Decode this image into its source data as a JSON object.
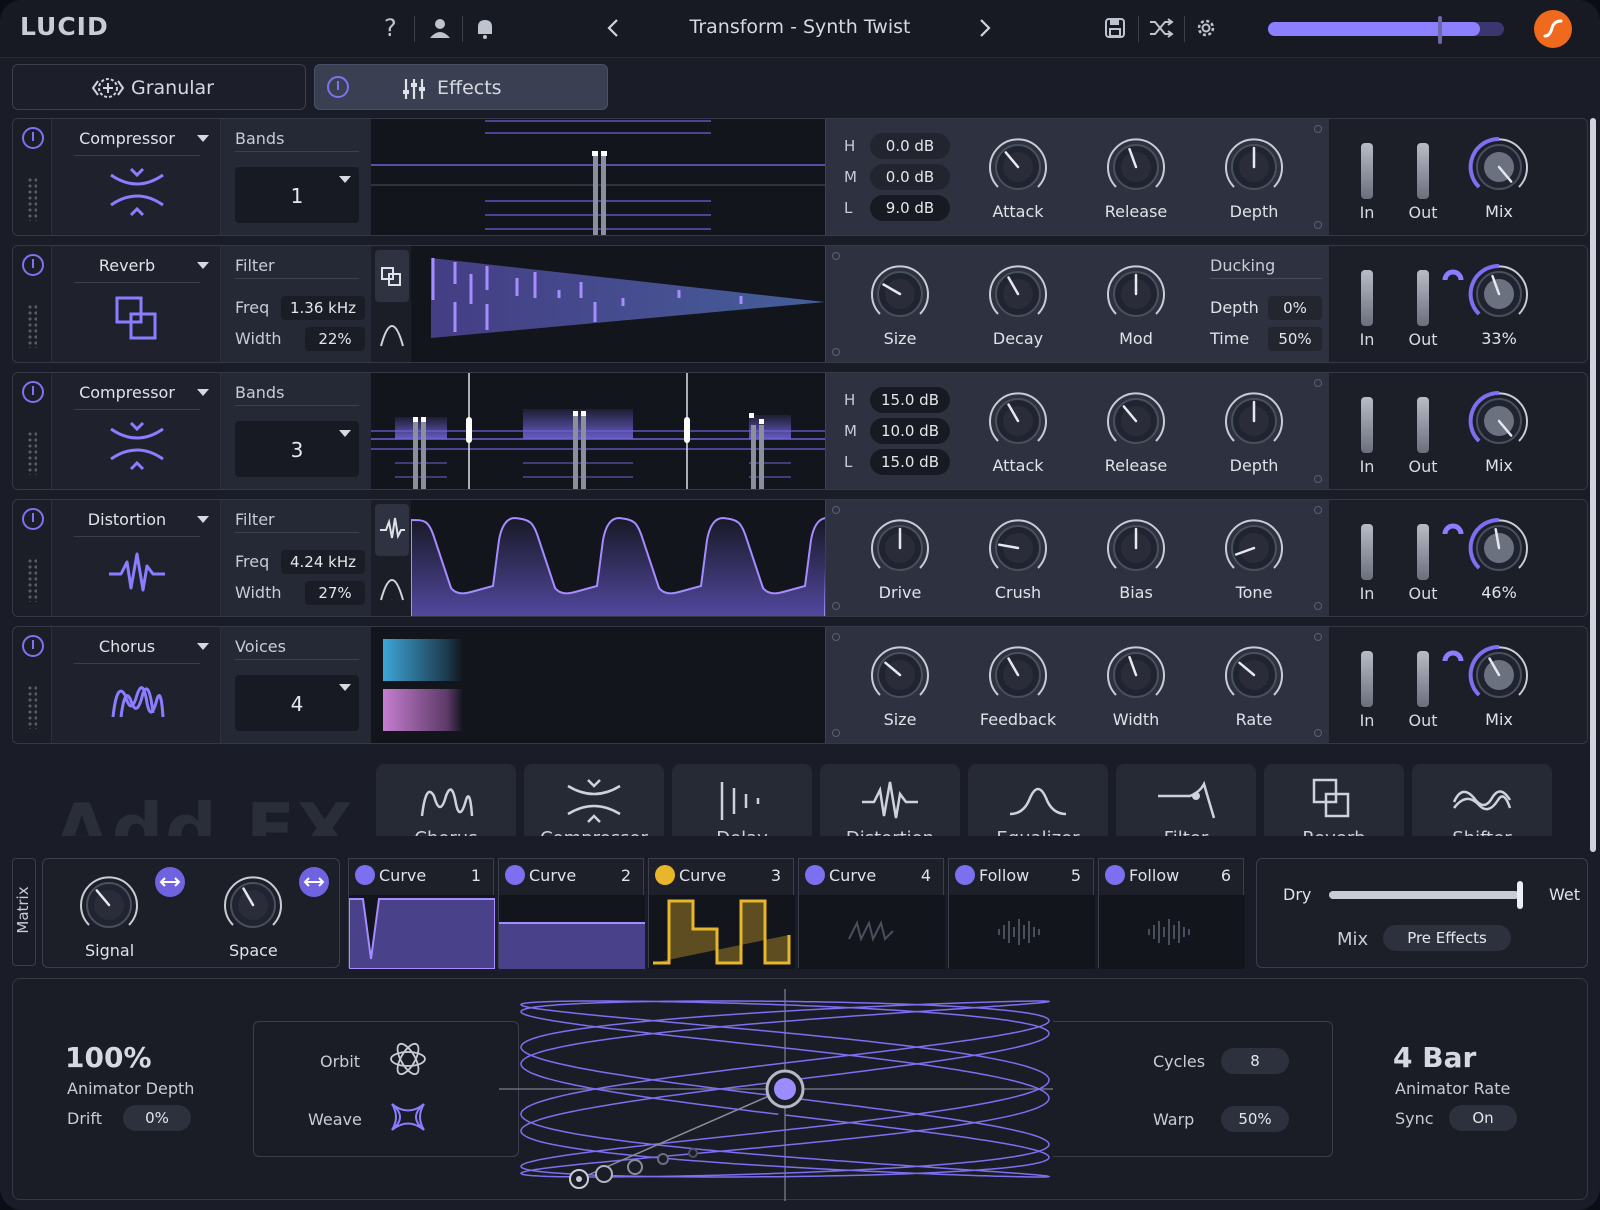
{
  "app": {
    "logo": "LUCID",
    "preset_name": "Transform - Synth Twist"
  },
  "header_icons": [
    "help-icon",
    "user-icon",
    "bell-icon",
    "prev-arrow-icon",
    "next-arrow-icon",
    "save-icon",
    "shuffle-icon",
    "gear-icon",
    "brand-icon"
  ],
  "master_volume": 0.9,
  "tabs": [
    {
      "label": "Granular"
    },
    {
      "label": "Effects",
      "active": true
    }
  ],
  "effects": [
    {
      "name": "Compressor",
      "param_header": "Bands",
      "selector_value": "1",
      "levels": [
        {
          "band": "H",
          "value": "0.0 dB"
        },
        {
          "band": "M",
          "value": "0.0 dB"
        },
        {
          "band": "L",
          "value": "9.0 dB"
        }
      ],
      "knobs": [
        "Attack",
        "Release",
        "Depth"
      ],
      "io": {
        "in": "In",
        "out": "Out",
        "mix": "Mix"
      }
    },
    {
      "name": "Reverb",
      "param_header": "Filter",
      "freq_label": "Freq",
      "freq": "1.36 kHz",
      "width_label": "Width",
      "width": "22%",
      "knobs": [
        "Size",
        "Decay",
        "Mod"
      ],
      "ducking": {
        "title": "Ducking",
        "depth_label": "Depth",
        "depth": "0%",
        "time_label": "Time",
        "time": "50%"
      },
      "io": {
        "in": "In",
        "out": "Out",
        "mix": "33%"
      }
    },
    {
      "name": "Compressor",
      "param_header": "Bands",
      "selector_value": "3",
      "levels": [
        {
          "band": "H",
          "value": "15.0 dB"
        },
        {
          "band": "M",
          "value": "10.0 dB"
        },
        {
          "band": "L",
          "value": "15.0 dB"
        }
      ],
      "knobs": [
        "Attack",
        "Release",
        "Depth"
      ],
      "io": {
        "in": "In",
        "out": "Out",
        "mix": "Mix"
      }
    },
    {
      "name": "Distortion",
      "param_header": "Filter",
      "freq_label": "Freq",
      "freq": "4.24 kHz",
      "width_label": "Width",
      "width": "27%",
      "knobs": [
        "Drive",
        "Crush",
        "Bias",
        "Tone"
      ],
      "io": {
        "in": "In",
        "out": "Out",
        "mix": "46%"
      }
    },
    {
      "name": "Chorus",
      "param_header": "Voices",
      "selector_value": "4",
      "knobs": [
        "Size",
        "Feedback",
        "Width",
        "Rate"
      ],
      "io": {
        "in": "In",
        "out": "Out",
        "mix": "Mix"
      }
    }
  ],
  "add_fx": {
    "title": "Add FX",
    "items": [
      "Chorus",
      "Compressor",
      "Delay",
      "Distortion",
      "Equalizer",
      "Filter",
      "Reverb",
      "Shifter"
    ]
  },
  "matrix": {
    "label": "Matrix",
    "knobs": [
      {
        "label": "Signal"
      },
      {
        "label": "Space"
      }
    ],
    "lfos": [
      {
        "type": "Curve",
        "num": "1"
      },
      {
        "type": "Curve",
        "num": "2"
      },
      {
        "type": "Curve",
        "num": "3"
      },
      {
        "type": "Curve",
        "num": "4"
      },
      {
        "type": "Follow",
        "num": "5"
      },
      {
        "type": "Follow",
        "num": "6"
      }
    ],
    "mix": {
      "dry": "Dry",
      "wet": "Wet",
      "label": "Mix",
      "mode": "Pre Effects",
      "value": 0.98
    }
  },
  "animator": {
    "depth_value": "100%",
    "depth_label": "Animator Depth",
    "drift_label": "Drift",
    "drift": "0%",
    "orbit_label": "Orbit",
    "weave_label": "Weave",
    "cycles_label": "Cycles",
    "cycles": "8",
    "warp_label": "Warp",
    "warp": "50%",
    "rate_value": "4 Bar",
    "rate_label": "Animator Rate",
    "sync_label": "Sync",
    "sync": "On"
  },
  "colors": {
    "accent": "#7c6ff0",
    "yellow": "#e7b62a",
    "orange": "#f06a1e",
    "panel": "#2e3240"
  }
}
